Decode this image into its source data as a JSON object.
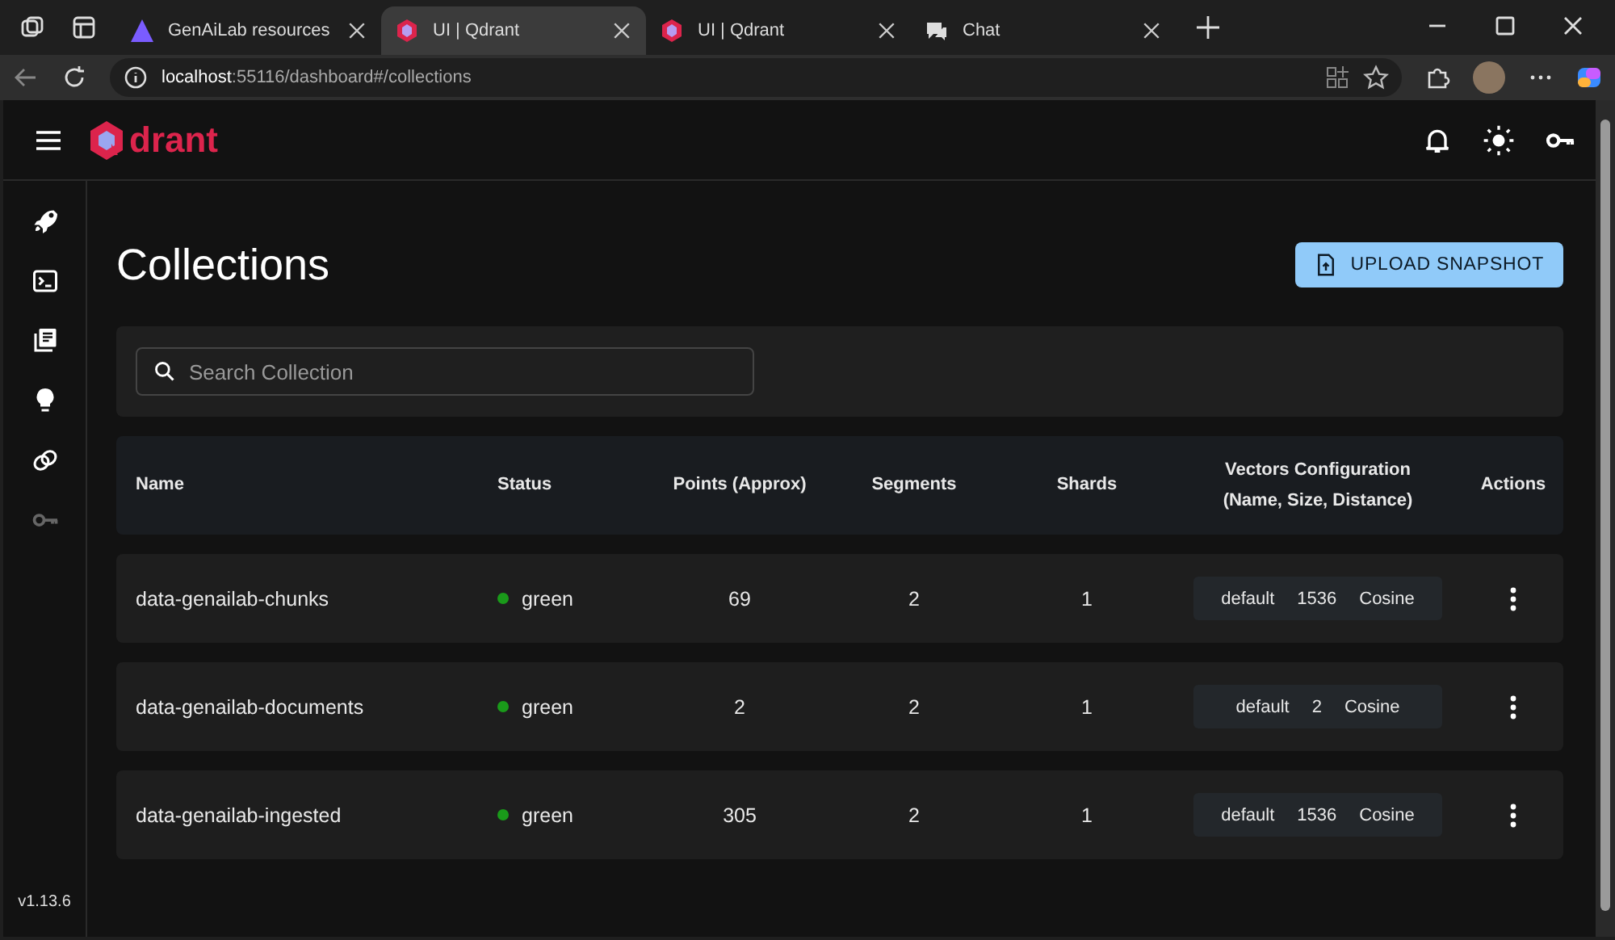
{
  "browser": {
    "tabs": [
      {
        "kind": "triangle",
        "title": "GenAiLab resources",
        "selected": false
      },
      {
        "kind": "qdrant",
        "title": "UI | Qdrant",
        "selected": true
      },
      {
        "kind": "qdrant",
        "title": "UI | Qdrant",
        "selected": false
      },
      {
        "kind": "chat",
        "title": "Chat",
        "selected": false
      }
    ],
    "url_host": "localhost",
    "url_path": ":55116/dashboard#/collections"
  },
  "app": {
    "logo_text": "drant",
    "version": "v1.13.6",
    "sidebar": [
      {
        "kind": "rocket",
        "disabled": false
      },
      {
        "kind": "terminal",
        "disabled": false
      },
      {
        "kind": "library",
        "disabled": false
      },
      {
        "kind": "bulb",
        "disabled": false
      },
      {
        "kind": "rings",
        "disabled": false
      },
      {
        "kind": "key",
        "disabled": true
      }
    ],
    "title": "Collections",
    "upload_button": "UPLOAD SNAPSHOT",
    "search": {
      "placeholder": "Search Collection"
    },
    "table": {
      "columns": [
        [
          "Name"
        ],
        [
          "Status"
        ],
        [
          "Points (Approx)"
        ],
        [
          "Segments"
        ],
        [
          "Shards"
        ],
        [
          "Vectors Configuration",
          "(Name, Size, Distance)"
        ],
        [
          "Actions"
        ]
      ],
      "rows": [
        {
          "name": "data-genailab-chunks",
          "status": "green",
          "color": "#1a9a1a",
          "points": "69",
          "segments": "2",
          "shards": "1",
          "vectors": [
            "default",
            "1536",
            "Cosine"
          ]
        },
        {
          "name": "data-genailab-documents",
          "status": "green",
          "color": "#1a9a1a",
          "points": "2",
          "segments": "2",
          "shards": "1",
          "vectors": [
            "default",
            "2",
            "Cosine"
          ]
        },
        {
          "name": "data-genailab-ingested",
          "status": "green",
          "color": "#1a9a1a",
          "points": "305",
          "segments": "2",
          "shards": "1",
          "vectors": [
            "default",
            "1536",
            "Cosine"
          ]
        }
      ]
    }
  }
}
